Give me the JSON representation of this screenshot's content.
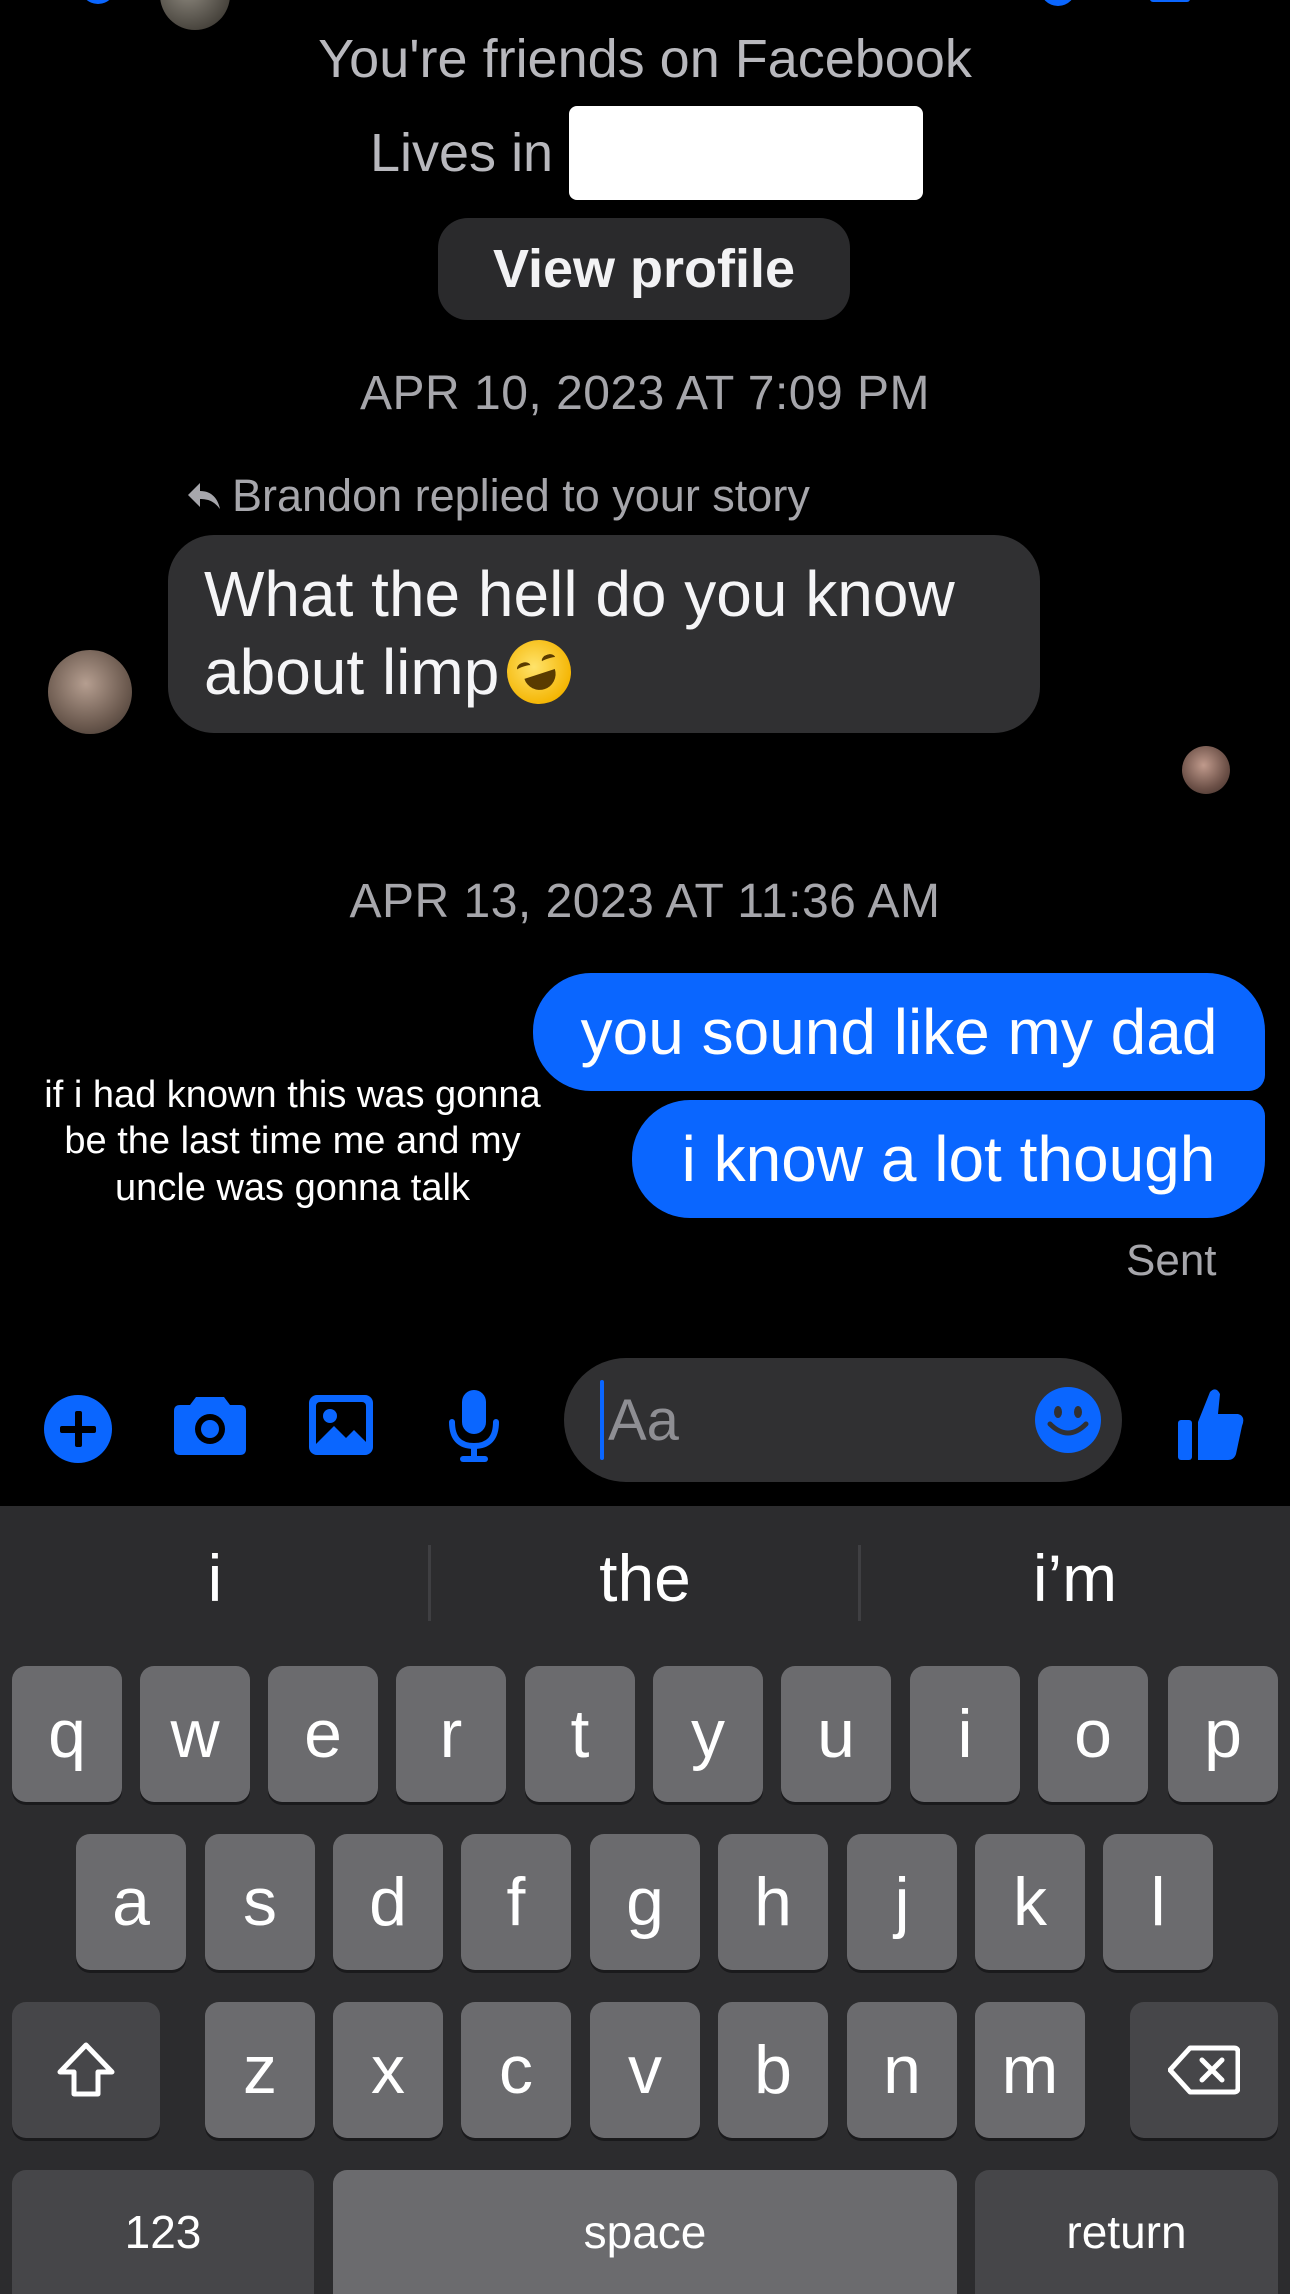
{
  "header": {
    "friends_text": "You're friends on Facebook",
    "lives_label": "Lives in",
    "view_profile_label": "View profile"
  },
  "conversation": {
    "timestamp_1": "APR 10, 2023 AT 7:09 PM",
    "reply_note": "Brandon replied to your story",
    "incoming_message_line1": "What the hell do you know",
    "incoming_message_line2": "about limp",
    "timestamp_2": "APR 13, 2023 AT 11:36 AM",
    "outgoing_messages": [
      "you sound like my dad",
      "i know a lot though"
    ],
    "status": "Sent"
  },
  "overlay_caption": "if i had known this was gonna be the last time me and my uncle was gonna talk",
  "composer": {
    "placeholder": "Aa",
    "icons": [
      "plus-icon",
      "camera-icon",
      "gallery-icon",
      "microphone-icon",
      "emoji-icon",
      "like-icon"
    ]
  },
  "keyboard": {
    "suggestions": [
      "i",
      "the",
      "i’m"
    ],
    "row1": [
      "q",
      "w",
      "e",
      "r",
      "t",
      "y",
      "u",
      "i",
      "o",
      "p"
    ],
    "row2": [
      "a",
      "s",
      "d",
      "f",
      "g",
      "h",
      "j",
      "k",
      "l"
    ],
    "row3": [
      "z",
      "x",
      "c",
      "v",
      "b",
      "n",
      "m"
    ],
    "numbers_label": "123",
    "space_label": "space",
    "return_label": "return"
  },
  "colors": {
    "accent": "#0a66ff",
    "bubble_incoming": "#303032",
    "background": "#000000",
    "keyboard": "#2c2c2e"
  }
}
